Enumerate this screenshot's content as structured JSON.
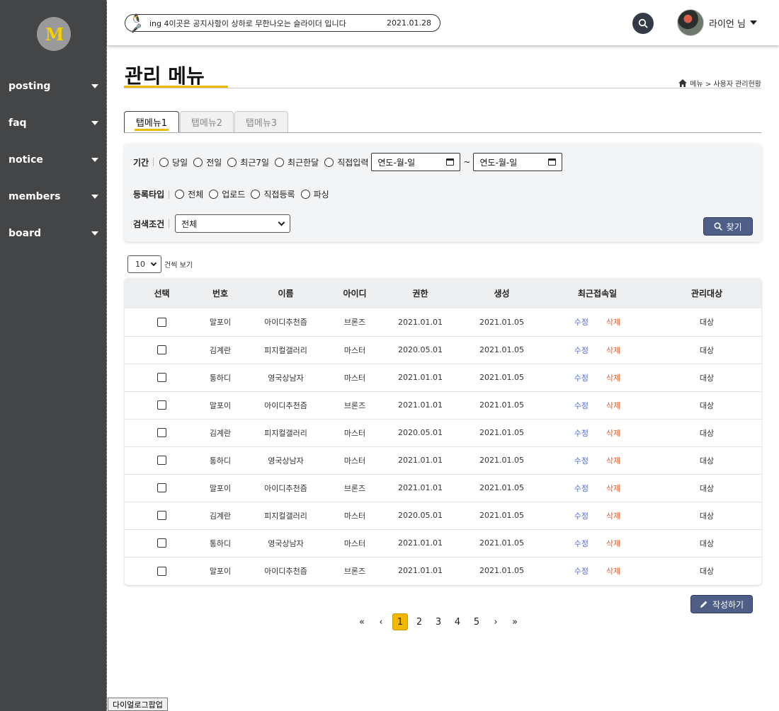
{
  "sidebar": {
    "logo": "M",
    "items": [
      {
        "label": "posting"
      },
      {
        "label": "faq"
      },
      {
        "label": "notice"
      },
      {
        "label": "members"
      },
      {
        "label": "board"
      }
    ],
    "dialog_button": "다이얼로그팝업"
  },
  "header": {
    "ticker_icons": "🐧🎤",
    "ticker_text": "ing 4이곳은 공지사항이 상하로 무한나오는 슬라이더 입니다",
    "ticker_date": "2021.01.28",
    "user_name": "라이언 님"
  },
  "page": {
    "title": "관리 메뉴",
    "breadcrumb": "메뉴 > 사용자 관리현황"
  },
  "tabs": [
    {
      "label": "탭메뉴1",
      "active": true
    },
    {
      "label": "탭메뉴2",
      "active": false
    },
    {
      "label": "탭메뉴3",
      "active": false
    }
  ],
  "filter": {
    "period_label": "기간",
    "period_options": [
      "당일",
      "전일",
      "최근7일",
      "최근한달",
      "직접입력"
    ],
    "date_from_placeholder": "연도-월-일",
    "date_separator": "~",
    "date_to_placeholder": "연도-월-일",
    "type_label": "등록타입",
    "type_options": [
      "전체",
      "업로드",
      "직접등록",
      "파싱"
    ],
    "condition_label": "검색조건",
    "condition_value": "전체",
    "find_button": "찾기"
  },
  "page_size": {
    "value": "10",
    "suffix": "건씩 보기"
  },
  "table": {
    "headers": [
      "선택",
      "번호",
      "이름",
      "아이디",
      "권한",
      "생성",
      "최근접속일",
      "관리대상"
    ],
    "edit_label": "수정",
    "delete_label": "삭제",
    "rows": [
      {
        "num": "말포이",
        "name": "아이디추천즘",
        "id": "브론즈",
        "auth": "2021.01.01",
        "created": "2021.01.05",
        "target": "대상"
      },
      {
        "num": "김계란",
        "name": "피지컬갤러리",
        "id": "마스터",
        "auth": "2020.05.01",
        "created": "2021.01.05",
        "target": "대상"
      },
      {
        "num": "통하디",
        "name": "영국상남자",
        "id": "마스터",
        "auth": "2021.01.01",
        "created": "2021.01.05",
        "target": "대상"
      },
      {
        "num": "말포이",
        "name": "아이디추천즘",
        "id": "브론즈",
        "auth": "2021.01.01",
        "created": "2021.01.05",
        "target": "대상"
      },
      {
        "num": "김계란",
        "name": "피지컬갤러리",
        "id": "마스터",
        "auth": "2020.05.01",
        "created": "2021.01.05",
        "target": "대상"
      },
      {
        "num": "통하디",
        "name": "영국상남자",
        "id": "마스터",
        "auth": "2021.01.01",
        "created": "2021.01.05",
        "target": "대상"
      },
      {
        "num": "말포이",
        "name": "아이디추천즘",
        "id": "브론즈",
        "auth": "2021.01.01",
        "created": "2021.01.05",
        "target": "대상"
      },
      {
        "num": "김계란",
        "name": "피지컬갤러리",
        "id": "마스터",
        "auth": "2020.05.01",
        "created": "2021.01.05",
        "target": "대상"
      },
      {
        "num": "통하디",
        "name": "영국상남자",
        "id": "마스터",
        "auth": "2021.01.01",
        "created": "2021.01.05",
        "target": "대상"
      },
      {
        "num": "말포이",
        "name": "아이디추천즘",
        "id": "브론즈",
        "auth": "2021.01.01",
        "created": "2021.01.05",
        "target": "대상"
      }
    ]
  },
  "write_button": "작성하기",
  "pagination": {
    "first": "«",
    "prev": "‹",
    "pages": [
      "1",
      "2",
      "3",
      "4",
      "5"
    ],
    "active": "1",
    "next": "›",
    "last": "»"
  },
  "colors": {
    "sidebar_bg": "#444547",
    "accent": "#f1b800",
    "button_bg": "#4e5e86",
    "edit": "#4a6ad8",
    "delete": "#e06030"
  }
}
